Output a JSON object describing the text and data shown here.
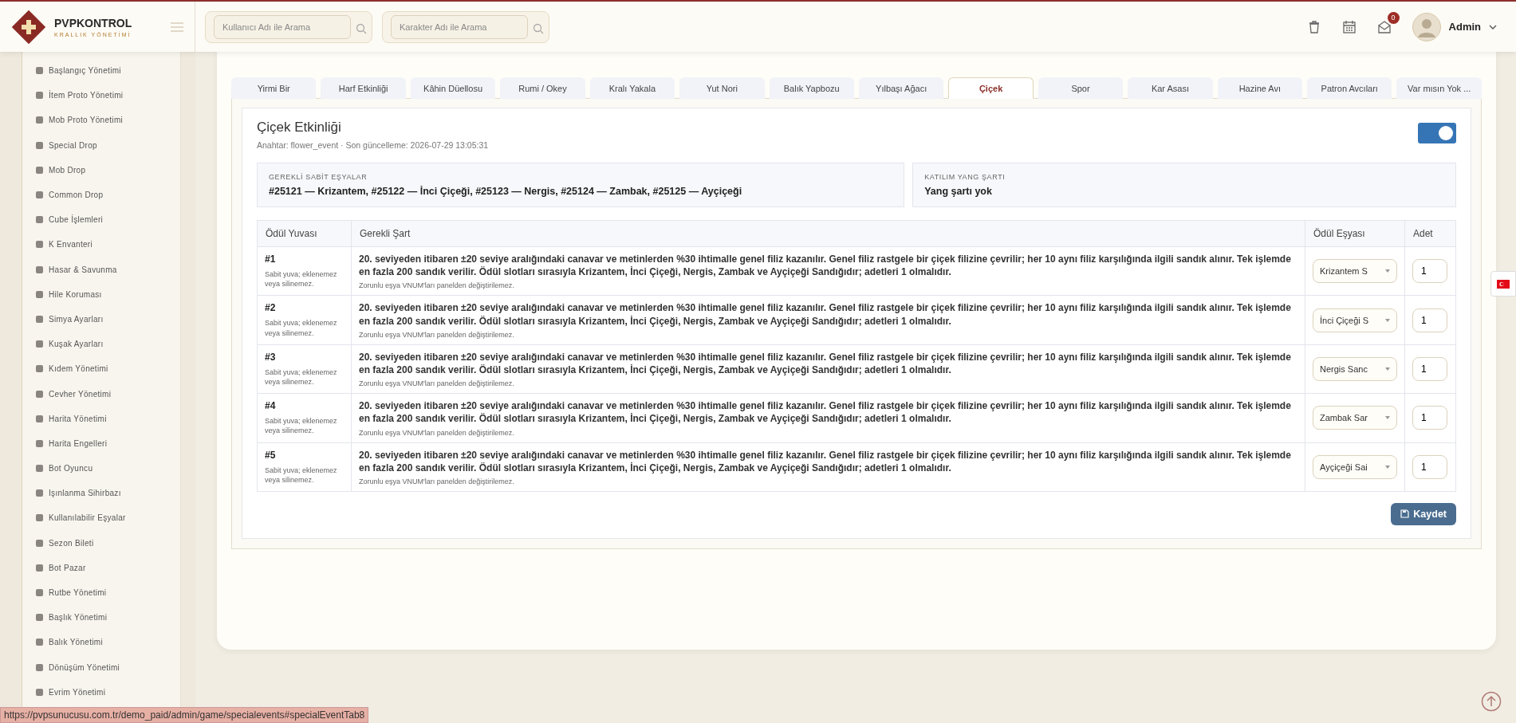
{
  "header": {
    "brand": "PVPKONTROL",
    "subtitle": "KRALLIK YÖNETİMİ",
    "searches": [
      {
        "placeholder": "Kullanıcı Adı ile Arama"
      },
      {
        "placeholder": "Karakter Adı ile Arama"
      }
    ],
    "mail_badge": "0",
    "user": "Admin"
  },
  "sidebar": {
    "items": [
      {
        "label": "Başlangıç Yönetimi"
      },
      {
        "label": "İtem Proto Yönetimi"
      },
      {
        "label": "Mob Proto Yönetimi"
      },
      {
        "label": "Special Drop"
      },
      {
        "label": "Mob Drop"
      },
      {
        "label": "Common Drop"
      },
      {
        "label": "Cube İşlemleri"
      },
      {
        "label": "K Envanteri"
      },
      {
        "label": "Hasar & Savunma"
      },
      {
        "label": "Hile Koruması"
      },
      {
        "label": "Simya Ayarları"
      },
      {
        "label": "Kuşak Ayarları"
      },
      {
        "label": "Kıdem Yönetimi"
      },
      {
        "label": "Cevher Yönetimi"
      },
      {
        "label": "Harita Yönetimi"
      },
      {
        "label": "Harita Engelleri"
      },
      {
        "label": "Bot Oyuncu"
      },
      {
        "label": "Işınlanma Sihirbazı"
      },
      {
        "label": "Kullanılabilir Eşyalar"
      },
      {
        "label": "Sezon Bileti"
      },
      {
        "label": "Bot Pazar"
      },
      {
        "label": "Rutbe Yönetimi"
      },
      {
        "label": "Başlık Yönetimi"
      },
      {
        "label": "Balık Yönetimi"
      },
      {
        "label": "Dönüşüm Yönetimi"
      },
      {
        "label": "Evrim Yönetimi"
      }
    ]
  },
  "tabs": [
    {
      "label": "Yirmi Bir",
      "selected": false
    },
    {
      "label": "Harf Etkinliği",
      "selected": false
    },
    {
      "label": "Kâhin Düellosu",
      "selected": false
    },
    {
      "label": "Rumi / Okey",
      "selected": false
    },
    {
      "label": "Kralı Yakala",
      "selected": false
    },
    {
      "label": "Yut Nori",
      "selected": false
    },
    {
      "label": "Balık Yapbozu",
      "selected": false
    },
    {
      "label": "Yılbaşı Ağacı",
      "selected": false
    },
    {
      "label": "Çiçek",
      "selected": true
    },
    {
      "label": "Spor",
      "selected": false
    },
    {
      "label": "Kar Asası",
      "selected": false
    },
    {
      "label": "Hazine Avı",
      "selected": false
    },
    {
      "label": "Patron Avcıları",
      "selected": false
    },
    {
      "label": "Var mısın Yok ...",
      "selected": false
    }
  ],
  "event": {
    "title": "Çiçek Etkinliği",
    "meta": "Anahtar: flower_event · Son güncelleme: 2026-07-29 13:05:31",
    "enabled": true,
    "info_boxes": [
      {
        "label": "GEREKLİ SABİT EŞYALAR",
        "value": "#25121 — Krizantem, #25122 — İnci Çiçeği, #25123 — Nergis, #25124 — Zambak, #25125 — Ayçiçeği"
      },
      {
        "label": "KATILIM YANG ŞARTI",
        "value": "Yang şartı yok"
      }
    ],
    "columns": [
      "Ödül Yuvası",
      "Gerekli Şart",
      "Ödül Eşyası",
      "Adet"
    ],
    "rows": [
      {
        "slot": "#1",
        "slot_note": "Sabit yuva; eklenemez veya silinemez.",
        "condition": "20. seviyeden itibaren ±20 seviye aralığındaki canavar ve metinlerden %30 ihtimalle genel filiz kazanılır. Genel filiz rastgele bir çiçek filizine çevrilir; her 10 aynı filiz karşılığında ilgili sandık alınır. Tek işlemde en fazla 200 sandık verilir. Ödül slotları sırasıyla Krizantem, İnci Çiçeği, Nergis, Zambak ve Ayçiçeği Sandığıdır; adetleri 1 olmalıdır.",
        "condition_note": "Zorunlu eşya VNUM'ları panelden değiştirilemez.",
        "reward_item": "Krizantem S",
        "amount": "1"
      },
      {
        "slot": "#2",
        "slot_note": "Sabit yuva; eklenemez veya silinemez.",
        "condition": "20. seviyeden itibaren ±20 seviye aralığındaki canavar ve metinlerden %30 ihtimalle genel filiz kazanılır. Genel filiz rastgele bir çiçek filizine çevrilir; her 10 aynı filiz karşılığında ilgili sandık alınır. Tek işlemde en fazla 200 sandık verilir. Ödül slotları sırasıyla Krizantem, İnci Çiçeği, Nergis, Zambak ve Ayçiçeği Sandığıdır; adetleri 1 olmalıdır.",
        "condition_note": "Zorunlu eşya VNUM'ları panelden değiştirilemez.",
        "reward_item": "İnci Çiçeği S",
        "amount": "1"
      },
      {
        "slot": "#3",
        "slot_note": "Sabit yuva; eklenemez veya silinemez.",
        "condition": "20. seviyeden itibaren ±20 seviye aralığındaki canavar ve metinlerden %30 ihtimalle genel filiz kazanılır. Genel filiz rastgele bir çiçek filizine çevrilir; her 10 aynı filiz karşılığında ilgili sandık alınır. Tek işlemde en fazla 200 sandık verilir. Ödül slotları sırasıyla Krizantem, İnci Çiçeği, Nergis, Zambak ve Ayçiçeği Sandığıdır; adetleri 1 olmalıdır.",
        "condition_note": "Zorunlu eşya VNUM'ları panelden değiştirilemez.",
        "reward_item": "Nergis Sanc",
        "amount": "1"
      },
      {
        "slot": "#4",
        "slot_note": "Sabit yuva; eklenemez veya silinemez.",
        "condition": "20. seviyeden itibaren ±20 seviye aralığındaki canavar ve metinlerden %30 ihtimalle genel filiz kazanılır. Genel filiz rastgele bir çiçek filizine çevrilir; her 10 aynı filiz karşılığında ilgili sandık alınır. Tek işlemde en fazla 200 sandık verilir. Ödül slotları sırasıyla Krizantem, İnci Çiçeği, Nergis, Zambak ve Ayçiçeği Sandığıdır; adetleri 1 olmalıdır.",
        "condition_note": "Zorunlu eşya VNUM'ları panelden değiştirilemez.",
        "reward_item": "Zambak Sar",
        "amount": "1"
      },
      {
        "slot": "#5",
        "slot_note": "Sabit yuva; eklenemez veya silinemez.",
        "condition": "20. seviyeden itibaren ±20 seviye aralığındaki canavar ve metinlerden %30 ihtimalle genel filiz kazanılır. Genel filiz rastgele bir çiçek filizine çevrilir; her 10 aynı filiz karşılığında ilgili sandık alınır. Tek işlemde en fazla 200 sandık verilir. Ödül slotları sırasıyla Krizantem, İnci Çiçeği, Nergis, Zambak ve Ayçiçeği Sandığıdır; adetleri 1 olmalıdır.",
        "condition_note": "Zorunlu eşya VNUM'ları panelden değiştirilemez.",
        "reward_item": "Ayçiçeği Sai",
        "amount": "1"
      }
    ],
    "save_button": "Kaydet"
  },
  "status_url": "https://pvpsunucusu.com.tr/demo_paid/admin/game/specialevents#specialEventTab8"
}
